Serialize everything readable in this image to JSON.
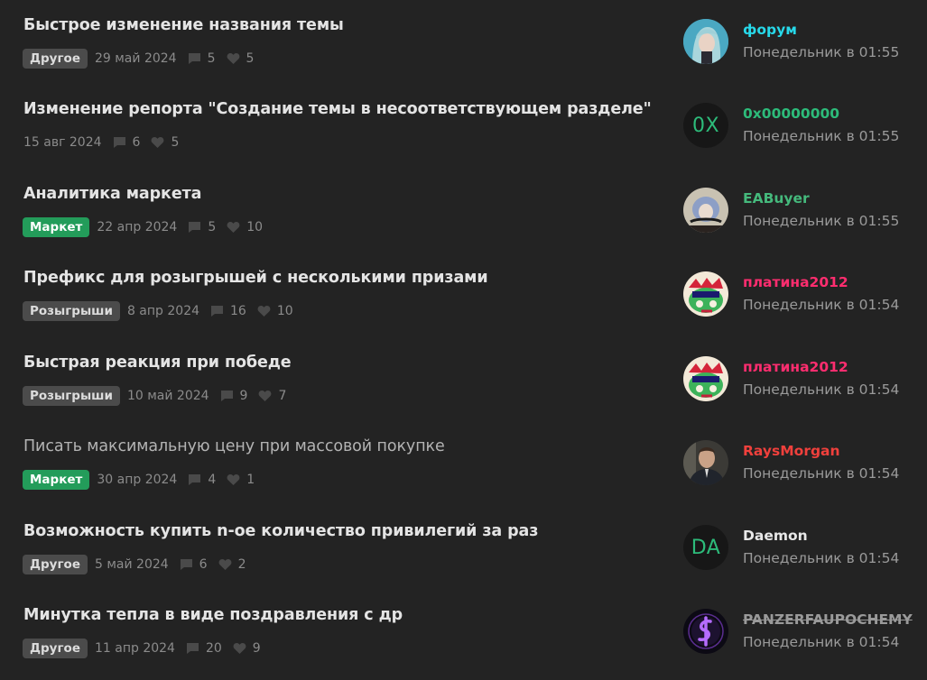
{
  "threads": [
    {
      "title": "Быстрое изменение названия темы",
      "prefix": "Другое",
      "date": "29 май 2024",
      "replies": "5",
      "likes": "5",
      "user": "форум",
      "last_post": "Понедельник в 01:55",
      "user_color": "#27d9ea",
      "avatar_icon": "anime-portrait-avatar"
    },
    {
      "title": "Изменение репорта \"Создание темы в несоответствующем разделе\"",
      "prefix": "",
      "date": "15 авг 2024",
      "replies": "6",
      "likes": "5",
      "user": "0x00000000",
      "last_post": "Понедельник в 01:55",
      "user_color": "#2dbb7a",
      "avatar_letters": "0X"
    },
    {
      "title": "Аналитика маркета",
      "prefix": "Маркет",
      "date": "22 апр 2024",
      "replies": "5",
      "likes": "10",
      "user": "EABuyer",
      "last_post": "Понедельник в 01:55",
      "user_color": "#45b97c",
      "avatar_icon": "anime-portrait-avatar"
    },
    {
      "title": "Префикс для розыгрышей с несколькими призами",
      "prefix": "Розыгрыши",
      "date": "8 апр 2024",
      "replies": "16",
      "likes": "10",
      "user": "платина2012",
      "last_post": "Понедельник в 01:54",
      "user_color": "#ff2d6f",
      "avatar_icon": "cartoon-character-avatar"
    },
    {
      "title": "Быстрая реакция при победе",
      "prefix": "Розыгрыши",
      "date": "10 май 2024",
      "replies": "9",
      "likes": "7",
      "user": "платина2012",
      "last_post": "Понедельник в 01:54",
      "user_color": "#ff2d6f",
      "avatar_icon": "cartoon-character-avatar"
    },
    {
      "title": "Писать максимальную цену при массовой покупке",
      "prefix": "Маркет",
      "date": "30 апр 2024",
      "replies": "4",
      "likes": "1",
      "user": "RaysMorgan",
      "last_post": "Понедельник в 01:54",
      "user_color": "#f0403c",
      "avatar_icon": "man-photo-avatar"
    },
    {
      "title": "Возможность купить n-ое количество привилегий за раз",
      "prefix": "Другое",
      "date": "5 май 2024",
      "replies": "6",
      "likes": "2",
      "user": "Daemon",
      "last_post": "Понедельник в 01:54",
      "user_color": "#e8e8e8",
      "avatar_letters": "DA"
    },
    {
      "title": "Минутка тепла в виде поздравления с др",
      "prefix": "Другое",
      "date": "11 апр 2024",
      "replies": "20",
      "likes": "9",
      "user": "PANZERFAUPOCHEMY",
      "last_post": "Понедельник в 01:54",
      "user_color": "#9a9a9a",
      "avatar_icon": "purple-glyph-avatar"
    }
  ],
  "colors": {
    "background": "#232323",
    "prefix_gray": "#4b4b4b",
    "prefix_green": "#239c5a"
  }
}
